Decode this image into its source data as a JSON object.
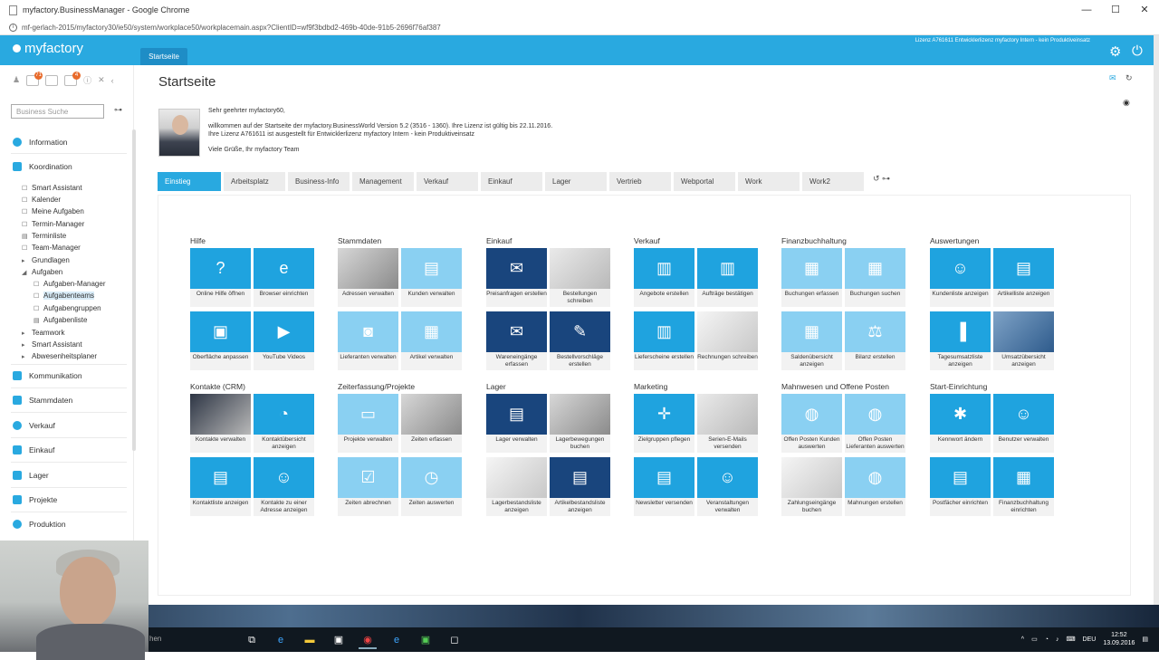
{
  "browser": {
    "title": "myfactory.BusinessManager - Google Chrome",
    "url": "mf-gerlach-2015/myfactory30/ie50/system/workplace50/workplacemain.aspx?ClientID=wf9f3bdbd2-469b-40de-91b5-2696f76af387",
    "controls": {
      "minimize": "—",
      "maximize": "☐",
      "close": "✕"
    }
  },
  "app": {
    "logo": "myfactory",
    "tab": "Startseite",
    "license": "Lizenz A761611 Entwicklerlizenz myfactory Intern - kein Produktiveinsatz"
  },
  "sidebar": {
    "search_placeholder": "Business Suche",
    "badge1": "71",
    "badge2": "4",
    "sections": [
      {
        "label": "Information"
      },
      {
        "label": "Koordination"
      }
    ],
    "subitems": [
      {
        "label": "Smart Assistant",
        "mark": "☐"
      },
      {
        "label": "Kalender",
        "mark": "☐"
      },
      {
        "label": "Meine Aufgaben",
        "mark": "☐"
      },
      {
        "label": "Termin-Manager",
        "mark": "☐"
      },
      {
        "label": "Terminliste",
        "mark": "▤"
      },
      {
        "label": "Team-Manager",
        "mark": "☐"
      },
      {
        "label": "Grundlagen",
        "mark": "▸"
      },
      {
        "label": "Aufgaben",
        "mark": "◢"
      }
    ],
    "subsubitems": [
      {
        "label": "Aufgaben-Manager",
        "mark": "☐"
      },
      {
        "label": "Aufgabenteams",
        "mark": "☐"
      },
      {
        "label": "Aufgabengruppen",
        "mark": "☐"
      },
      {
        "label": "Aufgabenliste",
        "mark": "▤"
      }
    ],
    "subitems2": [
      {
        "label": "Teamwork",
        "mark": "▸"
      },
      {
        "label": "Smart Assistant",
        "mark": "▸"
      },
      {
        "label": "Abwesenheitsplaner",
        "mark": "▸"
      }
    ],
    "modules": [
      {
        "label": "Kommunikation"
      },
      {
        "label": "Stammdaten"
      },
      {
        "label": "Verkauf"
      },
      {
        "label": "Einkauf"
      },
      {
        "label": "Lager"
      },
      {
        "label": "Projekte"
      },
      {
        "label": "Produktion"
      }
    ]
  },
  "main": {
    "title": "Startseite",
    "welcome": [
      "Sehr geehrter myfactory60,",
      "",
      "willkommen auf der Startseite der myfactory.BusinessWorld Version 5.2 (3516 - 1360). Ihre Lizenz ist gültig bis 22.11.2016.",
      "Ihre Lizenz A761611 ist ausgestellt für Entwicklerlizenz myfactory Intern - kein Produktiveinsatz",
      "",
      "Viele Grüße, Ihr myfactory Team"
    ],
    "tabs": [
      "Einstieg",
      "Arbeitsplatz",
      "Business-Info",
      "Management",
      "Verkauf",
      "Einkauf",
      "Lager",
      "Vertrieb",
      "Webportal",
      "Work",
      "Work2"
    ],
    "groups": [
      {
        "title": "Hilfe",
        "tiles": [
          {
            "label": "Online Hilfe öffnen",
            "color": "mid",
            "icon": "?"
          },
          {
            "label": "Browser einrichten",
            "color": "mid",
            "icon": "e"
          },
          {
            "label": "Oberfläche anpassen",
            "color": "mid",
            "icon": "▣"
          },
          {
            "label": "YouTube Videos",
            "color": "mid",
            "icon": "▶"
          }
        ]
      },
      {
        "title": "Stammdaten",
        "tiles": [
          {
            "label": "Adressen verwalten",
            "color": "photo",
            "icon": ""
          },
          {
            "label": "Kunden verwalten",
            "color": "light",
            "icon": "▤"
          },
          {
            "label": "Lieferanten verwalten",
            "color": "light",
            "icon": "◙"
          },
          {
            "label": "Artikel verwalten",
            "color": "light",
            "icon": "▦"
          }
        ]
      },
      {
        "title": "Einkauf",
        "tiles": [
          {
            "label": "Preisanfragen erstellen",
            "color": "dark",
            "icon": "✉"
          },
          {
            "label": "Bestellungen schreiben",
            "color": "photo2",
            "icon": ""
          },
          {
            "label": "Wareneingänge erfassen",
            "color": "dark",
            "icon": "✉"
          },
          {
            "label": "Bestellvorschläge erstellen",
            "color": "dark",
            "icon": "✎"
          }
        ]
      },
      {
        "title": "Verkauf",
        "tiles": [
          {
            "label": "Angebote erstellen",
            "color": "mid",
            "icon": "▥"
          },
          {
            "label": "Aufträge bestätigen",
            "color": "mid",
            "icon": "▥"
          },
          {
            "label": "Lieferscheine erstellen",
            "color": "mid",
            "icon": "▥"
          },
          {
            "label": "Rechnungen schreiben",
            "color": "photo4",
            "icon": ""
          }
        ]
      },
      {
        "title": "Finanzbuchhaltung",
        "tiles": [
          {
            "label": "Buchungen erfassen",
            "color": "light",
            "icon": "▦"
          },
          {
            "label": "Buchungen suchen",
            "color": "light",
            "icon": "▦"
          },
          {
            "label": "Saldenübersicht anzeigen",
            "color": "light",
            "icon": "▦"
          },
          {
            "label": "Bilanz erstellen",
            "color": "light",
            "icon": "⚖"
          }
        ]
      },
      {
        "title": "Auswertungen",
        "tiles": [
          {
            "label": "Kundenliste anzeigen",
            "color": "mid",
            "icon": "☺"
          },
          {
            "label": "Artikelliste anzeigen",
            "color": "mid",
            "icon": "▤"
          },
          {
            "label": "Tagesumsatzliste anzeigen",
            "color": "mid",
            "icon": "▐"
          },
          {
            "label": "Umsatzübersicht anzeigen",
            "color": "photo5",
            "icon": ""
          }
        ]
      },
      {
        "title": "Kontakte (CRM)",
        "tiles": [
          {
            "label": "Kontakte verwalten",
            "color": "photo3",
            "icon": ""
          },
          {
            "label": "Kontaktübersicht anzeigen",
            "color": "mid",
            "icon": "◔"
          },
          {
            "label": "Kontaktliste anzeigen",
            "color": "mid",
            "icon": "▤"
          },
          {
            "label": "Kontakte zu einer Adresse anzeigen",
            "color": "mid",
            "icon": "☺"
          }
        ]
      },
      {
        "title": "Zeiterfassung/Projekte",
        "tiles": [
          {
            "label": "Projekte verwalten",
            "color": "light",
            "icon": "▭"
          },
          {
            "label": "Zeiten erfassen",
            "color": "photo",
            "icon": ""
          },
          {
            "label": "Zeiten abrechnen",
            "color": "light",
            "icon": "☑"
          },
          {
            "label": "Zeiten auswerten",
            "color": "light",
            "icon": "◷"
          }
        ]
      },
      {
        "title": "Lager",
        "tiles": [
          {
            "label": "Lager verwalten",
            "color": "dark",
            "icon": "▤"
          },
          {
            "label": "Lagerbewegungen buchen",
            "color": "photo",
            "icon": ""
          },
          {
            "label": "Lagerbestandsliste anzeigen",
            "color": "photo4",
            "icon": ""
          },
          {
            "label": "Artikelbestandsliste anzeigen",
            "color": "dark",
            "icon": "▤"
          }
        ]
      },
      {
        "title": "Marketing",
        "tiles": [
          {
            "label": "Zielgruppen pflegen",
            "color": "mid",
            "icon": "✛"
          },
          {
            "label": "Serien-E-Mails versenden",
            "color": "photo2",
            "icon": ""
          },
          {
            "label": "Newsletter versenden",
            "color": "mid",
            "icon": "▤"
          },
          {
            "label": "Veranstaltungen verwalten",
            "color": "mid",
            "icon": "☺"
          }
        ]
      },
      {
        "title": "Mahnwesen und Offene Posten",
        "tiles": [
          {
            "label": "Offen Posten Kunden auswerten",
            "color": "light",
            "icon": "◍"
          },
          {
            "label": "Offen Posten Lieferanten auswerten",
            "color": "light",
            "icon": "◍"
          },
          {
            "label": "Zahlungseingänge buchen",
            "color": "photo4",
            "icon": ""
          },
          {
            "label": "Mahnungen erstellen",
            "color": "light",
            "icon": "◍"
          }
        ]
      },
      {
        "title": "Start-Einrichtung",
        "tiles": [
          {
            "label": "Kennwort ändern",
            "color": "mid",
            "icon": "✱"
          },
          {
            "label": "Benutzer verwalten",
            "color": "mid",
            "icon": "☺"
          },
          {
            "label": "Postfächer einrichten",
            "color": "mid",
            "icon": "▤"
          },
          {
            "label": "Finanzbuchhaltung einrichten",
            "color": "mid",
            "icon": "▦"
          }
        ]
      }
    ]
  },
  "taskbar": {
    "search": "hen",
    "lang": "DEU",
    "time": "12:52",
    "date": "13.09.2016"
  },
  "colors": {
    "accent": "#29a9e0",
    "tile_light": "#8ad0f2",
    "tile_mid": "#1fa3df",
    "tile_dark": "#19457d"
  }
}
